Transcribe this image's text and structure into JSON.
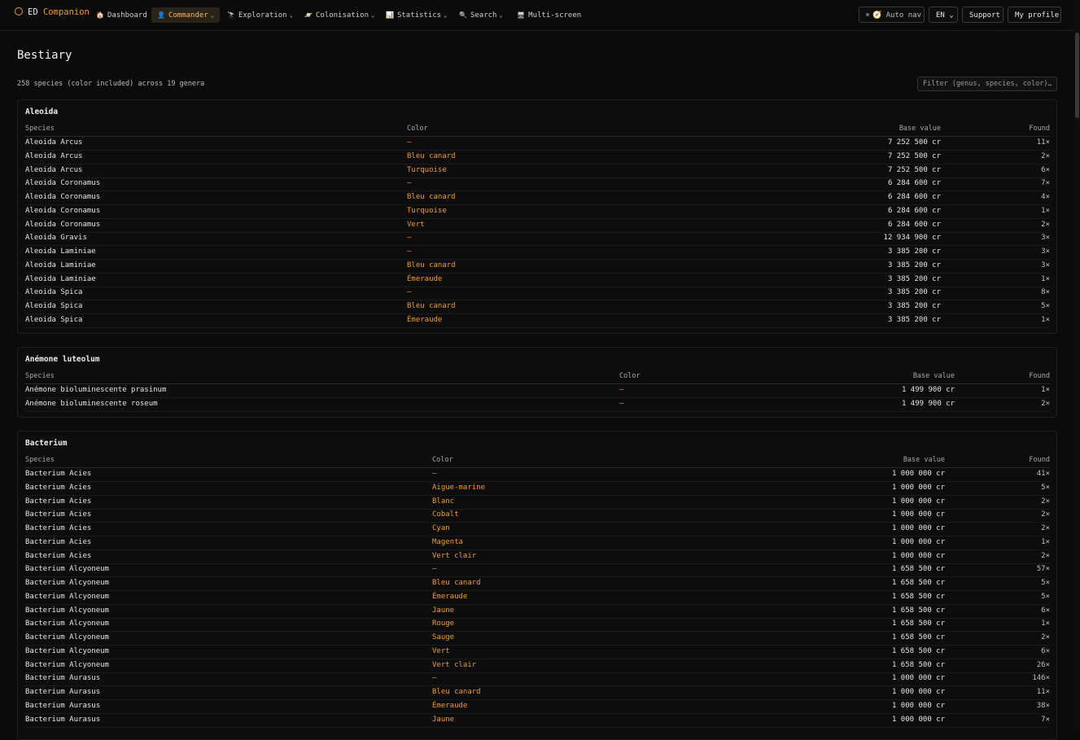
{
  "brand": {
    "part1": "ED",
    "part2": "Companion"
  },
  "nav": [
    {
      "icon": "🏠",
      "label": "Dashboard",
      "chevron": ""
    },
    {
      "icon": "👤",
      "label": "Commander",
      "chevron": "⌄"
    },
    {
      "icon": "🔭",
      "label": "Exploration",
      "chevron": "⌄"
    },
    {
      "icon": "🪐",
      "label": "Colonisation",
      "chevron": "⌄"
    },
    {
      "icon": "📊",
      "label": "Statistics",
      "chevron": "⌄"
    },
    {
      "icon": "🔍",
      "label": "Search",
      "chevron": "⌄"
    },
    {
      "icon": "🖥",
      "label": "Multi-screen",
      "chevron": ""
    }
  ],
  "topright": {
    "autonav": "Auto nav",
    "autonav_icon": "🧭",
    "lang": "EN",
    "lang_chevron": "⌄",
    "support": "Support",
    "profile": "My profile"
  },
  "page": {
    "title": "Bestiary",
    "summary": "258 species (color included) across 19 genera",
    "filter_placeholder": "Filter (genus, species, color)…"
  },
  "columns": {
    "species": "Species",
    "color": "Color",
    "value": "Base value",
    "found": "Found"
  },
  "genera": [
    {
      "name": "Aleoida",
      "rows": [
        [
          "Aleoida Arcus",
          "—",
          "7 252 500 cr",
          "11×"
        ],
        [
          "Aleoida Arcus",
          "Bleu canard",
          "7 252 500 cr",
          "2×"
        ],
        [
          "Aleoida Arcus",
          "Turquoise",
          "7 252 500 cr",
          "6×"
        ],
        [
          "Aleoida Coronamus",
          "—",
          "6 284 600 cr",
          "7×"
        ],
        [
          "Aleoida Coronamus",
          "Bleu canard",
          "6 284 600 cr",
          "4×"
        ],
        [
          "Aleoida Coronamus",
          "Turquoise",
          "6 284 600 cr",
          "1×"
        ],
        [
          "Aleoida Coronamus",
          "Vert",
          "6 284 600 cr",
          "2×"
        ],
        [
          "Aleoida Gravis",
          "—",
          "12 934 900 cr",
          "3×"
        ],
        [
          "Aleoida Laminiae",
          "—",
          "3 385 200 cr",
          "3×"
        ],
        [
          "Aleoida Laminiae",
          "Bleu canard",
          "3 385 200 cr",
          "3×"
        ],
        [
          "Aleoida Laminiae",
          "Émeraude",
          "3 385 200 cr",
          "1×"
        ],
        [
          "Aleoida Spica",
          "—",
          "3 385 200 cr",
          "8×"
        ],
        [
          "Aleoida Spica",
          "Bleu canard",
          "3 385 200 cr",
          "5×"
        ],
        [
          "Aleoida Spica",
          "Émeraude",
          "3 385 200 cr",
          "1×"
        ]
      ]
    },
    {
      "name": "Anémone luteolum",
      "rows": [
        [
          "Anémone bioluminescente prasinum",
          "—",
          "1 499 900 cr",
          "1×"
        ],
        [
          "Anémone bioluminescente roseum",
          "—",
          "1 499 900 cr",
          "2×"
        ]
      ]
    },
    {
      "name": "Bacterium",
      "rows": [
        [
          "Bacterium Acies",
          "—",
          "1 000 000 cr",
          "41×"
        ],
        [
          "Bacterium Acies",
          "Aigue-marine",
          "1 000 000 cr",
          "5×"
        ],
        [
          "Bacterium Acies",
          "Blanc",
          "1 000 000 cr",
          "2×"
        ],
        [
          "Bacterium Acies",
          "Cobalt",
          "1 000 000 cr",
          "2×"
        ],
        [
          "Bacterium Acies",
          "Cyan",
          "1 000 000 cr",
          "2×"
        ],
        [
          "Bacterium Acies",
          "Magenta",
          "1 000 000 cr",
          "1×"
        ],
        [
          "Bacterium Acies",
          "Vert clair",
          "1 000 000 cr",
          "2×"
        ],
        [
          "Bacterium Alcyoneum",
          "—",
          "1 658 500 cr",
          "57×"
        ],
        [
          "Bacterium Alcyoneum",
          "Bleu canard",
          "1 658 500 cr",
          "5×"
        ],
        [
          "Bacterium Alcyoneum",
          "Émeraude",
          "1 658 500 cr",
          "5×"
        ],
        [
          "Bacterium Alcyoneum",
          "Jaune",
          "1 658 500 cr",
          "6×"
        ],
        [
          "Bacterium Alcyoneum",
          "Rouge",
          "1 658 500 cr",
          "1×"
        ],
        [
          "Bacterium Alcyoneum",
          "Sauge",
          "1 658 500 cr",
          "2×"
        ],
        [
          "Bacterium Alcyoneum",
          "Vert",
          "1 658 500 cr",
          "6×"
        ],
        [
          "Bacterium Alcyoneum",
          "Vert clair",
          "1 658 500 cr",
          "26×"
        ],
        [
          "Bacterium Aurasus",
          "—",
          "1 000 000 cr",
          "146×"
        ],
        [
          "Bacterium Aurasus",
          "Bleu canard",
          "1 000 000 cr",
          "11×"
        ],
        [
          "Bacterium Aurasus",
          "Émeraude",
          "1 000 000 cr",
          "38×"
        ],
        [
          "Bacterium Aurasus",
          "Jaune",
          "1 000 000 cr",
          "7×"
        ]
      ]
    }
  ],
  "colors": {
    "accent": "#f39a2b",
    "background": "#0b0b0b",
    "text": "#e6e6e6"
  }
}
